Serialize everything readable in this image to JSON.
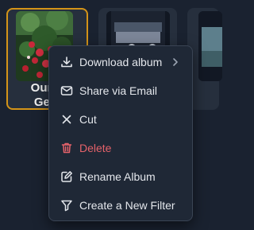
{
  "albums": [
    {
      "title": "Our C",
      "subtitle": "Geta",
      "selected": true
    },
    {
      "title": "",
      "subtitle": "",
      "selected": false
    },
    {
      "title": "",
      "subtitle": "",
      "selected": false
    }
  ],
  "context_menu": {
    "items": [
      {
        "label": "Download album",
        "icon": "download-icon",
        "has_submenu": true,
        "danger": false
      },
      {
        "label": "Share via Email",
        "icon": "mail-icon",
        "has_submenu": false,
        "danger": false
      },
      {
        "label": "Cut",
        "icon": "close-x-icon",
        "has_submenu": false,
        "danger": false
      },
      {
        "label": "Delete",
        "icon": "trash-icon",
        "has_submenu": false,
        "danger": true
      },
      {
        "label": "Rename Album",
        "icon": "edit-icon",
        "has_submenu": false,
        "danger": false
      },
      {
        "label": "Create a New Filter",
        "icon": "filter-icon",
        "has_submenu": false,
        "danger": false
      }
    ]
  },
  "colors": {
    "background": "#1a2230",
    "card": "#262f3d",
    "selected_border": "#d49418",
    "menu_background": "#1f2836",
    "danger": "#e5626a",
    "text": "#e4e7ec"
  }
}
